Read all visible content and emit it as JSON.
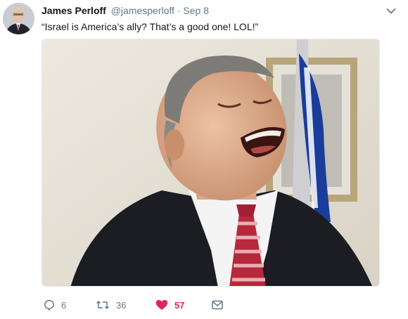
{
  "tweet": {
    "author_name": "James Perloff",
    "handle": "@jamesperloff",
    "separator": "·",
    "date": "Sep 8",
    "text": "“Israel is America’s ally? That’s a good one! LOL!”"
  },
  "actions": {
    "replies": "6",
    "retweets": "36",
    "likes": "57"
  },
  "icons": {
    "reply": "reply-icon",
    "retweet": "retweet-icon",
    "like": "heart-icon",
    "dm": "envelope-icon",
    "menu": "chevron-down-icon"
  },
  "colors": {
    "like_active": "#e0245e",
    "secondary_text": "#657786",
    "primary_text": "#14171a"
  }
}
